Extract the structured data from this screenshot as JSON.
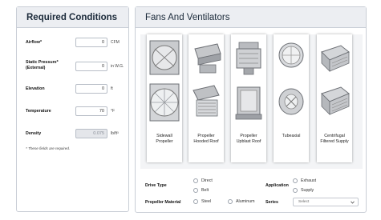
{
  "required_conditions": {
    "title": "Required Conditions",
    "fields": [
      {
        "label": "Airflow*",
        "value": "0",
        "unit": "CFM"
      },
      {
        "label": "Static Pressure*\n(External)",
        "value": "0",
        "unit": "in W.G."
      },
      {
        "label": "Elevation",
        "value": "0",
        "unit": "ft"
      },
      {
        "label": "Temperature",
        "value": "70",
        "unit": "°F"
      },
      {
        "label": "Density",
        "value": "0.075",
        "unit": "lb/ft³"
      }
    ],
    "note": "* These fields are required."
  },
  "fans": {
    "title": "Fans And Ventilators",
    "items": [
      {
        "name": "Sidewall\nPropeller",
        "icon": "sidewall-propeller-fan-icon"
      },
      {
        "name": "Propeller\nHooded Roof",
        "icon": "propeller-hooded-roof-fan-icon"
      },
      {
        "name": "Propeller\nUpblast Roof",
        "icon": "propeller-upblast-roof-fan-icon"
      },
      {
        "name": "Tubeaxial",
        "icon": "tubeaxial-fan-icon"
      },
      {
        "name": "Centrifugal\nFiltered Supply",
        "icon": "centrifugal-filtered-supply-icon"
      }
    ]
  },
  "options": {
    "drive_type": {
      "label": "Drive Type",
      "choices": [
        "Direct",
        "Belt"
      ]
    },
    "application": {
      "label": "Application",
      "choices": [
        "Exhaust",
        "Supply"
      ]
    },
    "propeller_material": {
      "label": "Propeller Material",
      "choices": [
        "Steel",
        "Aluminum"
      ]
    },
    "series": {
      "label": "Series",
      "placeholder": "Select"
    }
  }
}
